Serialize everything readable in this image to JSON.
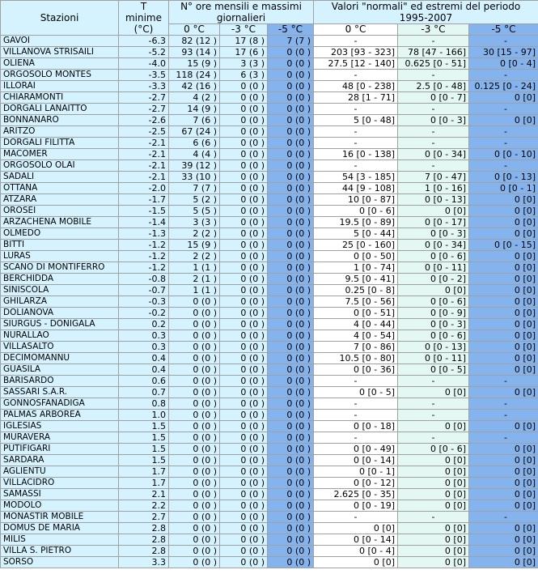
{
  "header": {
    "stazioni": "Stazioni",
    "tmin": "T minime (°C)",
    "ore_group": "N° ore mensili e massimi giornalieri",
    "normali_group": "Valori \"normali\" ed estremi del periodo 1995-2007",
    "sub": [
      "0 °C",
      "-3 °C",
      "-5 °C",
      "0 °C",
      "-3 °C",
      "-5 °C"
    ]
  },
  "rows": [
    {
      "stazione": "GAVOI",
      "tmin": "-6.3",
      "h0": "82 (12 )",
      "h3": "17 (8 )",
      "h5": "7 (7 )",
      "n0": "-",
      "n3": "-",
      "n5": "-"
    },
    {
      "stazione": "VILLANOVA STRISAILI",
      "tmin": "-5.2",
      "h0": "93 (14 )",
      "h3": "17 (6 )",
      "h5": "0 (0 )",
      "n0": "203 [93 - 323]",
      "n3": "78 [47 - 166]",
      "n5": "30 [15 - 97]"
    },
    {
      "stazione": "OLIENA",
      "tmin": "-4.0",
      "h0": "15 (9 )",
      "h3": "3 (3 )",
      "h5": "0 (0 )",
      "n0": "27.5 [12 - 140]",
      "n3": "0.625 [0 - 51]",
      "n5": "0 [0 - 4]"
    },
    {
      "stazione": "ORGOSOLO MONTES",
      "tmin": "-3.5",
      "h0": "118 (24 )",
      "h3": "6 (3 )",
      "h5": "0 (0 )",
      "n0": "-",
      "n3": "-",
      "n5": "-"
    },
    {
      "stazione": "ILLORAI",
      "tmin": "-3.3",
      "h0": "42 (16 )",
      "h3": "0 (0 )",
      "h5": "0 (0 )",
      "n0": "48 [0 - 238]",
      "n3": "2.5 [0 - 48]",
      "n5": "0.125 [0 - 24]"
    },
    {
      "stazione": "CHIARAMONTI",
      "tmin": "-2.7",
      "h0": "4 (2 )",
      "h3": "0 (0 )",
      "h5": "0 (0 )",
      "n0": "28 [1 - 71]",
      "n3": "0 [0 - 7]",
      "n5": "0 [0]"
    },
    {
      "stazione": "DORGALI LANAITTO",
      "tmin": "-2.7",
      "h0": "14 (9 )",
      "h3": "0 (0 )",
      "h5": "0 (0 )",
      "n0": "-",
      "n3": "-",
      "n5": "-"
    },
    {
      "stazione": "BONNANARO",
      "tmin": "-2.6",
      "h0": "7 (6 )",
      "h3": "0 (0 )",
      "h5": "0 (0 )",
      "n0": "5 [0 - 48]",
      "n3": "0 [0 - 3]",
      "n5": "0 [0]"
    },
    {
      "stazione": "ARITZO",
      "tmin": "-2.5",
      "h0": "67 (24 )",
      "h3": "0 (0 )",
      "h5": "0 (0 )",
      "n0": "-",
      "n3": "-",
      "n5": "-"
    },
    {
      "stazione": "DORGALI FILITTA",
      "tmin": "-2.1",
      "h0": "6 (6 )",
      "h3": "0 (0 )",
      "h5": "0 (0 )",
      "n0": "-",
      "n3": "-",
      "n5": "-"
    },
    {
      "stazione": "MACOMER",
      "tmin": "-2.1",
      "h0": "4 (4 )",
      "h3": "0 (0 )",
      "h5": "0 (0 )",
      "n0": "16 [0 - 138]",
      "n3": "0 [0 - 34]",
      "n5": "0 [0 - 10]"
    },
    {
      "stazione": "ORGOSOLO OLAI",
      "tmin": "-2.1",
      "h0": "39 (12 )",
      "h3": "0 (0 )",
      "h5": "0 (0 )",
      "n0": "-",
      "n3": "-",
      "n5": "-"
    },
    {
      "stazione": "SADALI",
      "tmin": "-2.1",
      "h0": "33 (10 )",
      "h3": "0 (0 )",
      "h5": "0 (0 )",
      "n0": "54 [3 - 185]",
      "n3": "7 [0 - 47]",
      "n5": "0 [0 - 13]"
    },
    {
      "stazione": "OTTANA",
      "tmin": "-2.0",
      "h0": "7 (7 )",
      "h3": "0 (0 )",
      "h5": "0 (0 )",
      "n0": "44 [9 - 108]",
      "n3": "1 [0 - 16]",
      "n5": "0 [0 - 1]"
    },
    {
      "stazione": "ATZARA",
      "tmin": "-1.7",
      "h0": "5 (2 )",
      "h3": "0 (0 )",
      "h5": "0 (0 )",
      "n0": "10 [0 - 87]",
      "n3": "0 [0 - 13]",
      "n5": "0 [0]"
    },
    {
      "stazione": "OROSEI",
      "tmin": "-1.5",
      "h0": "5 (5 )",
      "h3": "0 (0 )",
      "h5": "0 (0 )",
      "n0": "0 [0 - 6]",
      "n3": "0 [0]",
      "n5": "0 [0]"
    },
    {
      "stazione": "ARZACHENA MOBILE",
      "tmin": "-1.4",
      "h0": "3 (3 )",
      "h3": "0 (0 )",
      "h5": "0 (0 )",
      "n0": "19.5 [0 - 89]",
      "n3": "0 [0 - 17]",
      "n5": "0 [0]"
    },
    {
      "stazione": "OLMEDO",
      "tmin": "-1.3",
      "h0": "2 (2 )",
      "h3": "0 (0 )",
      "h5": "0 (0 )",
      "n0": "5 [0 - 44]",
      "n3": "0 [0 - 3]",
      "n5": "0 [0]"
    },
    {
      "stazione": "BITTI",
      "tmin": "-1.2",
      "h0": "15 (9 )",
      "h3": "0 (0 )",
      "h5": "0 (0 )",
      "n0": "25 [0 - 160]",
      "n3": "0 [0 - 34]",
      "n5": "0 [0 - 15]"
    },
    {
      "stazione": "LURAS",
      "tmin": "-1.2",
      "h0": "2 (2 )",
      "h3": "0 (0 )",
      "h5": "0 (0 )",
      "n0": "0 [0 - 50]",
      "n3": "0 [0 - 6]",
      "n5": "0 [0]"
    },
    {
      "stazione": "SCANO DI MONTIFERRO",
      "tmin": "-1.2",
      "h0": "1 (1 )",
      "h3": "0 (0 )",
      "h5": "0 (0 )",
      "n0": "1 [0 - 74]",
      "n3": "0 [0 - 11]",
      "n5": "0 [0]"
    },
    {
      "stazione": "BERCHIDDA",
      "tmin": "-0.8",
      "h0": "2 (1 )",
      "h3": "0 (0 )",
      "h5": "0 (0 )",
      "n0": "9.5 [0 - 41]",
      "n3": "0 [0 - 2]",
      "n5": "0 [0]"
    },
    {
      "stazione": "SINISCOLA",
      "tmin": "-0.7",
      "h0": "1 (1 )",
      "h3": "0 (0 )",
      "h5": "0 (0 )",
      "n0": "0.25 [0 - 8]",
      "n3": "0 [0]",
      "n5": "0 [0]"
    },
    {
      "stazione": "GHILARZA",
      "tmin": "-0.3",
      "h0": "0 (0 )",
      "h3": "0 (0 )",
      "h5": "0 (0 )",
      "n0": "7.5 [0 - 56]",
      "n3": "0 [0 - 6]",
      "n5": "0 [0]"
    },
    {
      "stazione": "DOLIANOVA",
      "tmin": "-0.2",
      "h0": "0 (0 )",
      "h3": "0 (0 )",
      "h5": "0 (0 )",
      "n0": "0 [0 - 51]",
      "n3": "0 [0 - 9]",
      "n5": "0 [0]"
    },
    {
      "stazione": "SIURGUS - DONIGALA",
      "tmin": "0.2",
      "h0": "0 (0 )",
      "h3": "0 (0 )",
      "h5": "0 (0 )",
      "n0": "4 [0 - 44]",
      "n3": "0 [0 - 3]",
      "n5": "0 [0]"
    },
    {
      "stazione": "NURALLAO",
      "tmin": "0.3",
      "h0": "0 (0 )",
      "h3": "0 (0 )",
      "h5": "0 (0 )",
      "n0": "4 [0 - 54]",
      "n3": "0 [0 - 6]",
      "n5": "0 [0]"
    },
    {
      "stazione": "VILLASALTO",
      "tmin": "0.3",
      "h0": "0 (0 )",
      "h3": "0 (0 )",
      "h5": "0 (0 )",
      "n0": "7 [0 - 86]",
      "n3": "0 [0 - 13]",
      "n5": "0 [0]"
    },
    {
      "stazione": "DECIMOMANNU",
      "tmin": "0.4",
      "h0": "0 (0 )",
      "h3": "0 (0 )",
      "h5": "0 (0 )",
      "n0": "10.5 [0 - 80]",
      "n3": "0 [0 - 11]",
      "n5": "0 [0]"
    },
    {
      "stazione": "GUASILA",
      "tmin": "0.4",
      "h0": "0 (0 )",
      "h3": "0 (0 )",
      "h5": "0 (0 )",
      "n0": "0 [0 - 36]",
      "n3": "0 [0 - 5]",
      "n5": "0 [0]"
    },
    {
      "stazione": "BARISARDO",
      "tmin": "0.6",
      "h0": "0 (0 )",
      "h3": "0 (0 )",
      "h5": "0 (0 )",
      "n0": "-",
      "n3": "-",
      "n5": "-"
    },
    {
      "stazione": "SASSARI S.A.R.",
      "tmin": "0.7",
      "h0": "0 (0 )",
      "h3": "0 (0 )",
      "h5": "0 (0 )",
      "n0": "0 [0 - 5]",
      "n3": "0 [0]",
      "n5": "0 [0]"
    },
    {
      "stazione": "GONNOSFANADIGA",
      "tmin": "0.8",
      "h0": "0 (0 )",
      "h3": "0 (0 )",
      "h5": "0 (0 )",
      "n0": "-",
      "n3": "-",
      "n5": "-"
    },
    {
      "stazione": "PALMAS ARBOREA",
      "tmin": "1.0",
      "h0": "0 (0 )",
      "h3": "0 (0 )",
      "h5": "0 (0 )",
      "n0": "-",
      "n3": "-",
      "n5": "-"
    },
    {
      "stazione": "IGLESIAS",
      "tmin": "1.5",
      "h0": "0 (0 )",
      "h3": "0 (0 )",
      "h5": "0 (0 )",
      "n0": "0 [0 - 18]",
      "n3": "0 [0]",
      "n5": "0 [0]"
    },
    {
      "stazione": "MURAVERA",
      "tmin": "1.5",
      "h0": "0 (0 )",
      "h3": "0 (0 )",
      "h5": "0 (0 )",
      "n0": "-",
      "n3": "-",
      "n5": "-"
    },
    {
      "stazione": "PUTIFIGARI",
      "tmin": "1.5",
      "h0": "0 (0 )",
      "h3": "0 (0 )",
      "h5": "0 (0 )",
      "n0": "0 [0 - 49]",
      "n3": "0 [0 - 6]",
      "n5": "0 [0]"
    },
    {
      "stazione": "SARDARA",
      "tmin": "1.5",
      "h0": "0 (0 )",
      "h3": "0 (0 )",
      "h5": "0 (0 )",
      "n0": "0 [0 - 14]",
      "n3": "0 [0]",
      "n5": "0 [0]"
    },
    {
      "stazione": "AGLIENTU",
      "tmin": "1.7",
      "h0": "0 (0 )",
      "h3": "0 (0 )",
      "h5": "0 (0 )",
      "n0": "0 [0 - 1]",
      "n3": "0 [0]",
      "n5": "0 [0]"
    },
    {
      "stazione": "VILLACIDRO",
      "tmin": "1.7",
      "h0": "0 (0 )",
      "h3": "0 (0 )",
      "h5": "0 (0 )",
      "n0": "0 [0 - 12]",
      "n3": "0 [0]",
      "n5": "0 [0]"
    },
    {
      "stazione": "SAMASSI",
      "tmin": "2.1",
      "h0": "0 (0 )",
      "h3": "0 (0 )",
      "h5": "0 (0 )",
      "n0": "2.625 [0 - 35]",
      "n3": "0 [0]",
      "n5": "0 [0]"
    },
    {
      "stazione": "MODOLO",
      "tmin": "2.2",
      "h0": "0 (0 )",
      "h3": "0 (0 )",
      "h5": "0 (0 )",
      "n0": "0 [0 - 19]",
      "n3": "0 [0]",
      "n5": "0 [0]"
    },
    {
      "stazione": "MONASTIR MOBILE",
      "tmin": "2.7",
      "h0": "0 (0 )",
      "h3": "0 (0 )",
      "h5": "0 (0 )",
      "n0": "-",
      "n3": "-",
      "n5": "-"
    },
    {
      "stazione": "DOMUS DE MARIA",
      "tmin": "2.8",
      "h0": "0 (0 )",
      "h3": "0 (0 )",
      "h5": "0 (0 )",
      "n0": "0 [0]",
      "n3": "0 [0]",
      "n5": "0 [0]"
    },
    {
      "stazione": "MILIS",
      "tmin": "2.8",
      "h0": "0 (0 )",
      "h3": "0 (0 )",
      "h5": "0 (0 )",
      "n0": "0 [0 - 14]",
      "n3": "0 [0]",
      "n5": "0 [0]"
    },
    {
      "stazione": "VILLA S. PIETRO",
      "tmin": "2.8",
      "h0": "0 (0 )",
      "h3": "0 (0 )",
      "h5": "0 (0 )",
      "n0": "0 [0 - 4]",
      "n3": "0 [0]",
      "n5": "0 [0]"
    },
    {
      "stazione": "SORSO",
      "tmin": "3.3",
      "h0": "0 (0 )",
      "h3": "0 (0 )",
      "h5": "0 (0 )",
      "n0": "0 [0]",
      "n3": "0 [0]",
      "n5": "0 [0]"
    }
  ]
}
